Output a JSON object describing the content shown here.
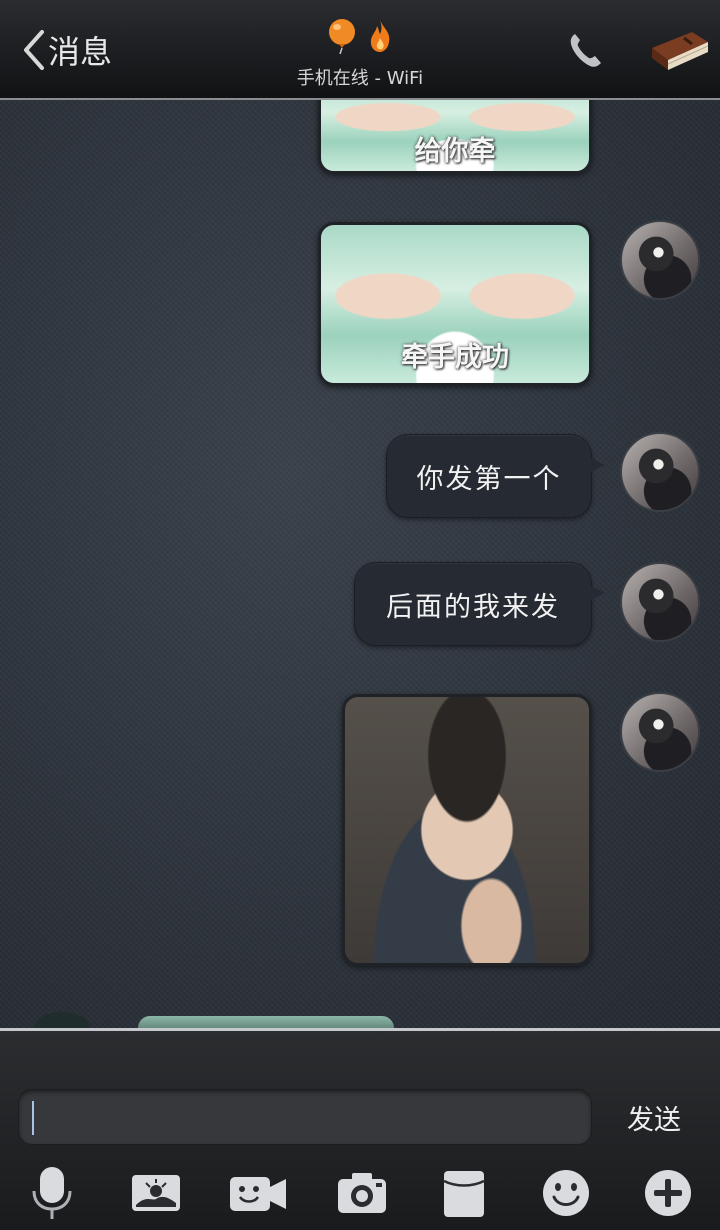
{
  "header": {
    "back_label": "消息",
    "subtitle": "手机在线 - WiFi",
    "icons": [
      "balloon-icon",
      "flame-icon",
      "phone-icon",
      "profile-book-icon"
    ]
  },
  "messages": [
    {
      "type": "image",
      "caption": "给你牵"
    },
    {
      "type": "image",
      "caption": "牵手成功"
    },
    {
      "type": "text",
      "text": "你发第一个"
    },
    {
      "type": "text",
      "text": "后面的我来发"
    },
    {
      "type": "image",
      "caption": ""
    }
  ],
  "input": {
    "value": "",
    "placeholder": "",
    "send_label": "发送"
  },
  "toolbar": {
    "items": [
      "microphone-icon",
      "picture-icon",
      "video-icon",
      "camera-icon",
      "card-icon",
      "smiley-icon",
      "plus-icon"
    ]
  },
  "colors": {
    "accent_orange": "#f08a24",
    "chat_bg": "#2e343d"
  }
}
